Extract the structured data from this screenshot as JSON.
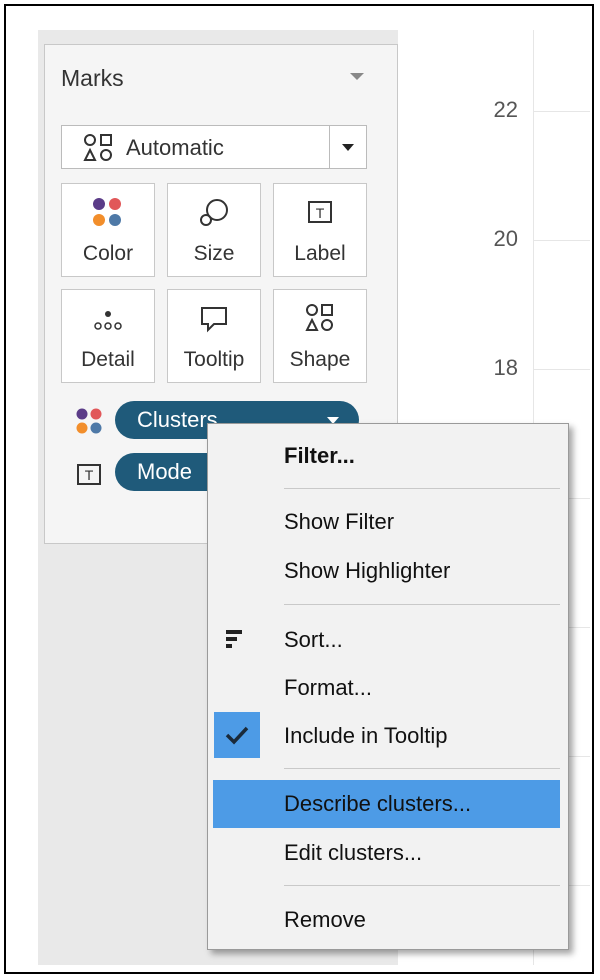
{
  "axis": {
    "ticks": [
      "22",
      "20",
      "18"
    ]
  },
  "marks": {
    "title": "Marks",
    "mark_type": "Automatic",
    "buttons": {
      "color": "Color",
      "size": "Size",
      "label": "Label",
      "detail": "Detail",
      "tooltip": "Tooltip",
      "shape": "Shape"
    },
    "pills": {
      "clusters": "Clusters",
      "model": "Mode"
    }
  },
  "menu": {
    "items": {
      "filter": "Filter...",
      "show_filter": "Show Filter",
      "show_highlighter": "Show Highlighter",
      "sort": "Sort...",
      "format": "Format...",
      "include_tooltip": "Include in Tooltip",
      "describe_clusters": "Describe clusters...",
      "edit_clusters": "Edit clusters...",
      "remove": "Remove"
    },
    "highlighted": "Describe clusters..."
  },
  "colors": {
    "pill": "#1f5a7a",
    "highlight": "#4d9be6",
    "dot_purple": "#5b3c88",
    "dot_red": "#e15759",
    "dot_orange": "#f28e2b",
    "dot_blue": "#4e79a7"
  }
}
